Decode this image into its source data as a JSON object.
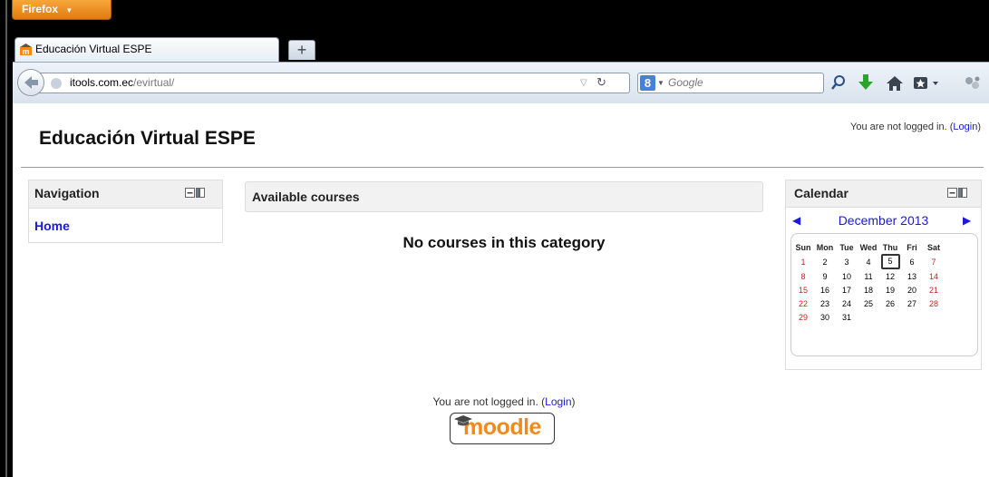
{
  "browser": {
    "app_button": "Firefox",
    "tab_title": "Educación Virtual ESPE",
    "new_tab": "+",
    "url_host": "itools.com.ec",
    "url_path": "/evirtual/",
    "search_placeholder": "Google"
  },
  "page": {
    "site_title": "Educación Virtual ESPE",
    "login_info_prefix": "You are not logged in. (",
    "login_link": "Login",
    "login_info_suffix": ")"
  },
  "navigation": {
    "title": "Navigation",
    "items": [
      {
        "label": "Home"
      }
    ]
  },
  "main": {
    "heading": "Available courses",
    "empty_message": "No courses in this category"
  },
  "calendar": {
    "title": "Calendar",
    "month": "December 2013",
    "weekdays": [
      "Sun",
      "Mon",
      "Tue",
      "Wed",
      "Thu",
      "Fri",
      "Sat"
    ],
    "weeks": [
      [
        "1",
        "2",
        "3",
        "4",
        "5",
        "6",
        "7"
      ],
      [
        "8",
        "9",
        "10",
        "11",
        "12",
        "13",
        "14"
      ],
      [
        "15",
        "16",
        "17",
        "18",
        "19",
        "20",
        "21"
      ],
      [
        "22",
        "23",
        "24",
        "25",
        "26",
        "27",
        "28"
      ],
      [
        "29",
        "30",
        "31",
        "",
        "",
        "",
        ""
      ]
    ],
    "today": "5"
  },
  "footer": {
    "login_info_prefix": "You are not logged in. (",
    "login_link": "Login",
    "login_info_suffix": ")",
    "logo_text": "moodle"
  },
  "colors": {
    "link": "#1a1ad8",
    "weekend": "#cc2222",
    "firefox_orange": "#e8891f"
  }
}
